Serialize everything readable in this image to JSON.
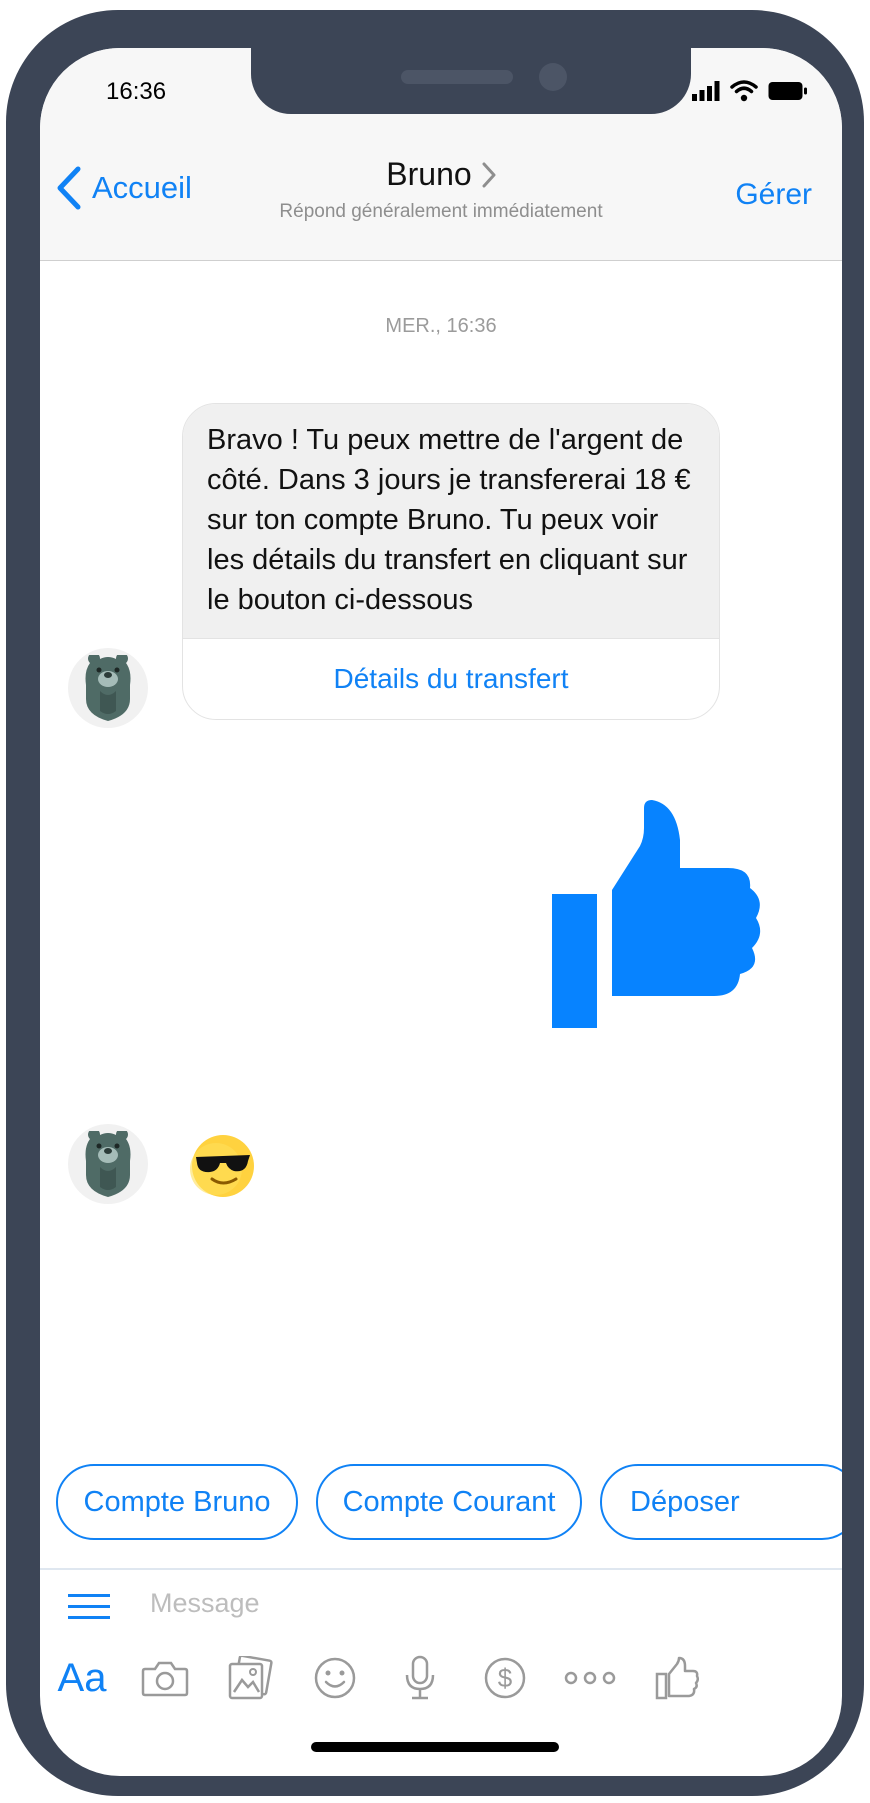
{
  "status_bar": {
    "time": "16:36"
  },
  "header": {
    "back_label": "Accueil",
    "title": "Bruno",
    "subtitle": "Répond généralement immédiatement",
    "manage_label": "Gérer"
  },
  "chat": {
    "timestamp": "MER., 16:36",
    "bot_message": "Bravo ! Tu peux mettre de l'argent de côté. Dans 3 jours je transfererai 18 € sur ton compte Bruno. Tu peux voir les détails du transfert en cliquant sur le bouton ci-dessous",
    "bot_button": "Détails du transfert",
    "user_reaction": "thumbs-up-icon",
    "bot_emoji": "sunglasses-emoji"
  },
  "quick_replies": [
    "Compte Bruno",
    "Compte Courant",
    "Déposer"
  ],
  "composer": {
    "placeholder": "Message",
    "text_format_label": "Aa",
    "tools": [
      "camera-icon",
      "gallery-icon",
      "smiley-icon",
      "microphone-icon",
      "payment-icon",
      "more-icon",
      "like-icon"
    ]
  },
  "colors": {
    "accent": "#1082f5",
    "frame": "#3c4556",
    "bubble_bg": "#f0f0f0"
  }
}
